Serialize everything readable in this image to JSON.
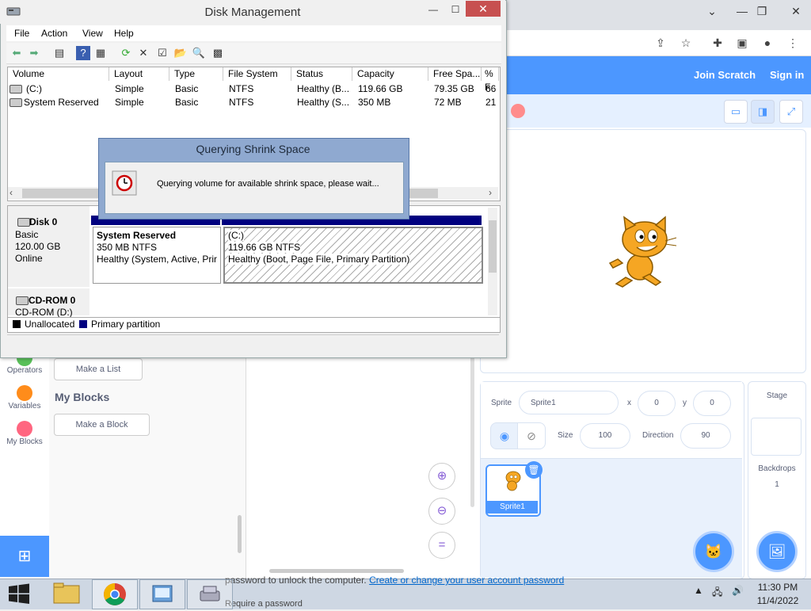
{
  "scratch": {
    "join": "Join Scratch",
    "signin": "Sign in",
    "categories": [
      {
        "label": "Operators",
        "color": "#59c059"
      },
      {
        "label": "Variables",
        "color": "#ff8c1a"
      },
      {
        "label": "My Blocks",
        "color": "#ff6680"
      }
    ],
    "make_list": "Make a List",
    "my_blocks_heading": "My Blocks",
    "make_block": "Make a Block",
    "zoom_in": "+",
    "zoom_out": "−",
    "zoom_reset": "=",
    "sprite": {
      "label": "Sprite",
      "name": "Sprite1",
      "x_label": "x",
      "x": "0",
      "y_label": "y",
      "y": "0",
      "size_label": "Size",
      "size": "100",
      "direction_label": "Direction",
      "direction": "90",
      "thumb_label": "Sprite1"
    },
    "stage": {
      "label": "Stage",
      "backdrops_label": "Backdrops",
      "backdrops_count": "1"
    },
    "accent": "#4c97ff"
  },
  "background_text": {
    "pw_prefix": "password to unlock the computer.",
    "pw_link": "Create or change your user account password",
    "require": "Require a password"
  },
  "disk_mgmt": {
    "title": "Disk Management",
    "menu": [
      "File",
      "Action",
      "View",
      "Help"
    ],
    "columns": [
      "Volume",
      "Layout",
      "Type",
      "File System",
      "Status",
      "Capacity",
      "Free Spa...",
      "% F"
    ],
    "rows": [
      [
        "(C:)",
        "Simple",
        "Basic",
        "NTFS",
        "Healthy (B...",
        "119.66 GB",
        "79.35 GB",
        "66"
      ],
      [
        "System Reserved",
        "Simple",
        "Basic",
        "NTFS",
        "Healthy (S...",
        "350 MB",
        "72 MB",
        "21"
      ]
    ],
    "disk0": {
      "name": "Disk 0",
      "type": "Basic",
      "size": "120.00 GB",
      "state": "Online",
      "part1": {
        "name": "System Reserved",
        "size": "350 MB NTFS",
        "status": "Healthy (System, Active, Prir"
      },
      "part2": {
        "name": "(C:)",
        "size": "119.66 GB NTFS",
        "status": "Healthy (Boot, Page File, Primary Partition)"
      }
    },
    "cdrom0": {
      "name": "CD-ROM 0",
      "drive": "CD-ROM (D:)"
    },
    "legend": [
      {
        "label": "Unallocated",
        "color": "#000000"
      },
      {
        "label": "Primary partition",
        "color": "#00007f"
      }
    ]
  },
  "dialog": {
    "title": "Querying Shrink Space",
    "message": "Querying volume for available shrink space, please wait..."
  },
  "taskbar": {
    "time": "11:30 PM",
    "date": "11/4/2022",
    "apps": [
      "file-explorer",
      "chrome",
      "control-panel",
      "disk-management"
    ]
  }
}
